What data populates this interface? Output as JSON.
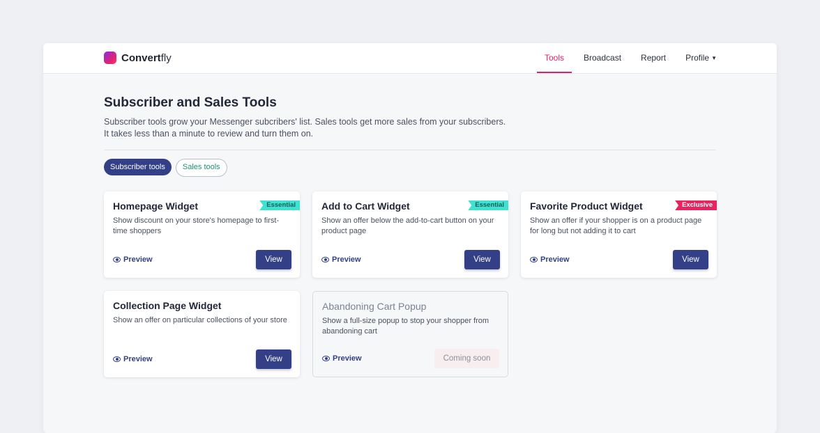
{
  "app": {
    "brand_bold": "Convert",
    "brand_light": "fly"
  },
  "nav": {
    "items": [
      {
        "label": "Tools"
      },
      {
        "label": "Broadcast"
      },
      {
        "label": "Report"
      },
      {
        "label": "Profile"
      }
    ],
    "active": "Tools",
    "profile_icon": "chevron-down-icon"
  },
  "page": {
    "title": "Subscriber and Sales Tools",
    "desc_line1": "Subscriber tools grow your Messenger subcribers' list. Sales tools get more sales from your subscribers.",
    "desc_line2": "It takes less than a minute to review and turn them on."
  },
  "filters": [
    {
      "label": "Subscriber tools",
      "active": true
    },
    {
      "label": "Sales tools",
      "active": false
    }
  ],
  "cards": [
    {
      "title": "Homepage Widget",
      "badge": "Essential",
      "desc": "Show discount on your store's homepage to first-time shoppers",
      "preview": "Preview",
      "action": "View"
    },
    {
      "title": "Add to Cart Widget",
      "badge": "Essential",
      "desc": "Show an offer below the add-to-cart button on your product page",
      "preview": "Preview",
      "action": "View"
    },
    {
      "title": "Favorite Product Widget",
      "badge": "Exclusive",
      "desc": "Show an offer if your shopper is on a product page for long but not adding it to cart",
      "preview": "Preview",
      "action": "View"
    },
    {
      "title": "Collection Page Widget",
      "badge": "",
      "desc": "Show an offer on particular collections of your store",
      "preview": "Preview",
      "action": "View"
    },
    {
      "title": "Abandoning Cart Popup",
      "badge": "",
      "desc": "Show a full-size popup to stop your shopper from abandoning cart",
      "preview": "Preview",
      "action": "Coming soon"
    }
  ],
  "colors": {
    "accent": "#e0206a",
    "primary": "#333f86",
    "essential": "#3fe2d0",
    "exclusive": "#e8245e"
  }
}
